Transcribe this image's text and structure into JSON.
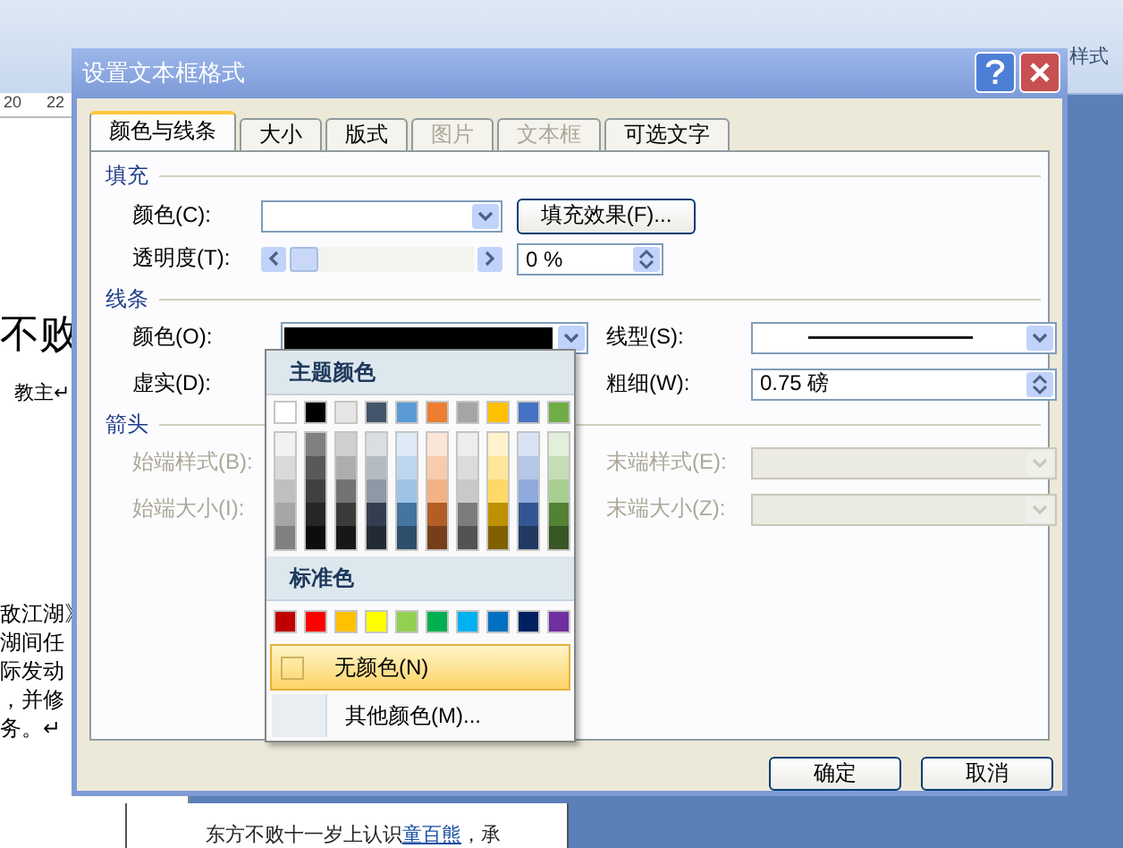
{
  "background": {
    "ribbon_label": "样式",
    "ruler_numbers": [
      "20",
      "22"
    ],
    "doc_lines_upper": [
      {
        "text": "不败",
        "kind": "big"
      },
      {
        "text": "教主↵",
        "kind": "small"
      }
    ],
    "doc_lines_lower": [
      "敌江湖》",
      "湖间任",
      "际发动",
      "，并修",
      "务。↵"
    ],
    "bottom_line": "东方不败十一岁上认识",
    "bottom_link": "童百熊",
    "bottom_tail": "，承"
  },
  "dialog": {
    "title": "设置文本框格式",
    "tabs": [
      {
        "label": "颜色与线条",
        "selected": true,
        "disabled": false
      },
      {
        "label": "大小",
        "selected": false,
        "disabled": false
      },
      {
        "label": "版式",
        "selected": false,
        "disabled": false
      },
      {
        "label": "图片",
        "selected": false,
        "disabled": true
      },
      {
        "label": "文本框",
        "selected": false,
        "disabled": true
      },
      {
        "label": "可选文字",
        "selected": false,
        "disabled": false
      }
    ],
    "fill": {
      "title": "填充",
      "color_label": "颜色(C):",
      "effects_button": "填充效果(F)...",
      "transparency": {
        "label": "透明度(T):",
        "level": 0,
        "value": "0 %"
      }
    },
    "line": {
      "title": "线条",
      "color_label": "颜色(O):",
      "color": "#000000",
      "dash_label": "虚实(D):",
      "style_label": "线型(S):",
      "weight_label": "粗细(W):",
      "weight_value": "0.75 磅"
    },
    "arrows": {
      "title": "箭头",
      "disabled": true,
      "begin_style_label": "始端样式(B):",
      "end_style_label": "末端样式(E):",
      "begin_size_label": "始端大小(I):",
      "end_size_label": "末端大小(Z):"
    },
    "buttons": [
      "确定",
      "取消"
    ]
  },
  "color_menu": {
    "theme_title": "主题颜色",
    "theme_colors": [
      {
        "color": "#ffffff"
      },
      {
        "color": "#000000"
      },
      {
        "color": "#e7e6e6"
      },
      {
        "color": "#44546a"
      },
      {
        "color": "#5b9bd5"
      },
      {
        "color": "#ed7d31"
      },
      {
        "color": "#a5a5a5"
      },
      {
        "color": "#ffc000"
      },
      {
        "color": "#4472c4"
      },
      {
        "color": "#70ad47"
      }
    ],
    "standard_title": "标准色",
    "standard_colors": [
      {
        "color": "#c00000"
      },
      {
        "color": "#ff0000"
      },
      {
        "color": "#ffc000"
      },
      {
        "color": "#ffff00"
      },
      {
        "color": "#92d050"
      },
      {
        "color": "#00b050"
      },
      {
        "color": "#00b0f0"
      },
      {
        "color": "#0070c0"
      },
      {
        "color": "#002060"
      },
      {
        "color": "#7030a0"
      }
    ],
    "no_color": {
      "label": "无颜色(N)",
      "selected": true
    },
    "more_colors": "其他颜色(M)..."
  }
}
